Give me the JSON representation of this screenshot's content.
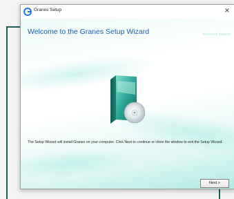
{
  "window": {
    "title": "Granes Setup",
    "watermark": "Advanced Installer",
    "close_glyph": "×"
  },
  "content": {
    "headline": "Welcome to the Granes Setup Wizard",
    "description": "The Setup Wizard will install Granes on your computer. Click Next to continue or close the window to exit the Setup Wizard."
  },
  "buttons": {
    "next_label": "Next >"
  },
  "icons": {
    "app": "setup-app-icon",
    "product": "software-box-with-disc-icon"
  },
  "colors": {
    "accent": "#1a5fa8",
    "teal": "#2aa394",
    "bracket": "#1d5f57"
  }
}
